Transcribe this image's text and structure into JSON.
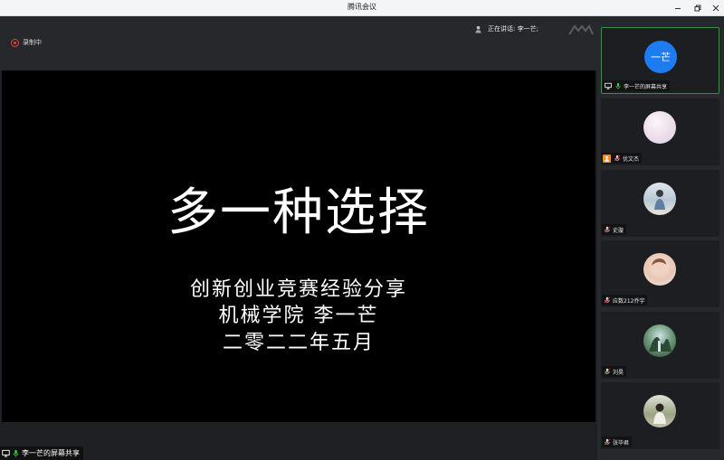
{
  "window": {
    "title": "腾讯会议"
  },
  "topbar": {
    "recording_label": "录制中",
    "speaking_label": "正在讲话: 李一芒;"
  },
  "slide": {
    "title": "多一种选择",
    "subtitle_lines": [
      "创新创业竞赛经验分享",
      "机械学院  李一芒",
      "二零二二年五月"
    ]
  },
  "share_tag": {
    "label": "李一芒的屏幕共享"
  },
  "participants": [
    {
      "name": "李一芒的屏幕共享",
      "avatar_text": "一芒",
      "avatar_color": "#1d7cf2",
      "active": true,
      "role": "presenter"
    },
    {
      "name": "优文杰",
      "avatar_text": "",
      "avatar_color": "#e9dde6",
      "active": false,
      "role": "host"
    },
    {
      "name": "史璇",
      "avatar_text": "",
      "avatar_color": "#b8c9d4",
      "active": false,
      "role": "member"
    },
    {
      "name": "应数212乔宇",
      "avatar_text": "",
      "avatar_color": "#e8c6b4",
      "active": false,
      "role": "member"
    },
    {
      "name": "刘昊",
      "avatar_text": "",
      "avatar_color": "#44624b",
      "active": false,
      "role": "member"
    },
    {
      "name": "张毕君",
      "avatar_text": "",
      "avatar_color": "#9aa384",
      "active": false,
      "role": "member"
    }
  ],
  "colors": {
    "accent_green": "#3c8d4a",
    "record_red": "#e2443a",
    "host_orange": "#f08a24",
    "mic_green": "#35c24a"
  }
}
